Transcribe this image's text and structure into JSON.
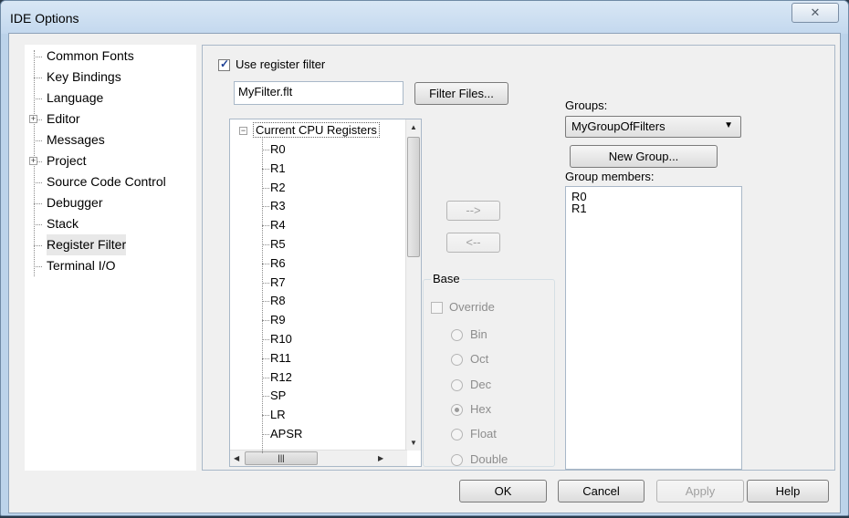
{
  "window": {
    "title": "IDE Options",
    "close_glyph": "✕"
  },
  "nav": {
    "items": [
      {
        "label": "Common Fonts",
        "expandable": false
      },
      {
        "label": "Key Bindings",
        "expandable": false
      },
      {
        "label": "Language",
        "expandable": false
      },
      {
        "label": "Editor",
        "expandable": true
      },
      {
        "label": "Messages",
        "expandable": false
      },
      {
        "label": "Project",
        "expandable": true
      },
      {
        "label": "Source Code Control",
        "expandable": false
      },
      {
        "label": "Debugger",
        "expandable": false
      },
      {
        "label": "Stack",
        "expandable": false
      },
      {
        "label": "Register Filter",
        "expandable": false,
        "selected": true
      },
      {
        "label": "Terminal I/O",
        "expandable": false
      }
    ],
    "expand_glyph": "+"
  },
  "filter": {
    "use_label": "Use register filter",
    "use_checked": true,
    "file_value": "MyFilter.flt",
    "filter_files_button": "Filter Files..."
  },
  "register_tree": {
    "root": "Current CPU Registers",
    "collapse_glyph": "−",
    "children": [
      "R0",
      "R1",
      "R2",
      "R3",
      "R4",
      "R5",
      "R6",
      "R7",
      "R8",
      "R9",
      "R10",
      "R11",
      "R12",
      "SP",
      "LR",
      "APSR"
    ]
  },
  "move_buttons": {
    "add": "-->",
    "remove": "<--"
  },
  "base": {
    "title": "Base",
    "override_label": "Override",
    "options": [
      "Bin",
      "Oct",
      "Dec",
      "Hex",
      "Float",
      "Double"
    ],
    "selected": "Hex"
  },
  "groups": {
    "label": "Groups:",
    "selected": "MyGroupOfFilters",
    "new_group_button": "New Group...",
    "members_label": "Group members:",
    "members": [
      "R0",
      "R1"
    ]
  },
  "footer": {
    "ok": "OK",
    "cancel": "Cancel",
    "apply": "Apply",
    "help": "Help"
  }
}
